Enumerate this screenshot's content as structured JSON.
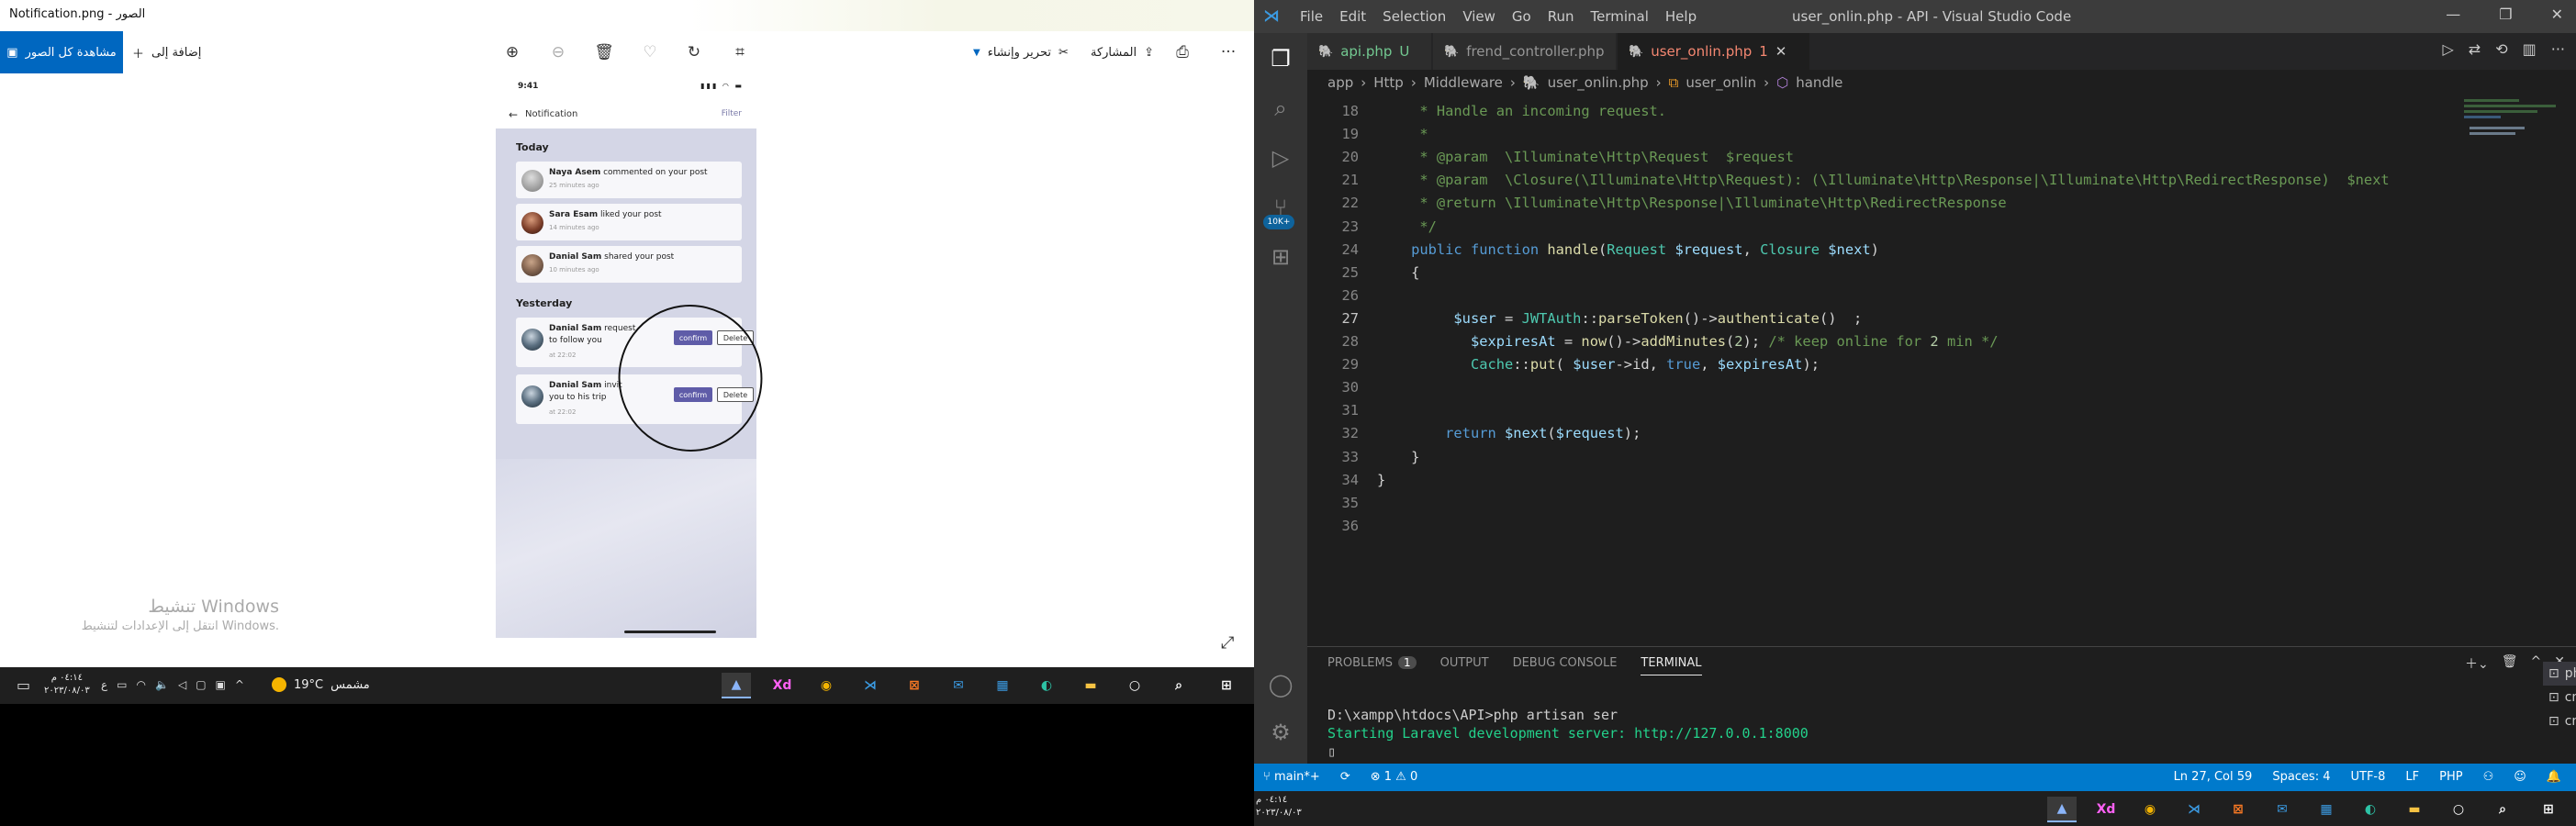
{
  "photos": {
    "window_title": "Notification.png - الصور",
    "toolbar": {
      "view_all": "مشاهدة كل الصور",
      "add_to": "إضافة إلى",
      "edit_create": "تحرير وإنشاء",
      "share": "المشاركة",
      "more": "···"
    },
    "phone": {
      "time": "9:41",
      "back_label": "Notification",
      "filter": "Filter",
      "today": "Today",
      "yesterday": "Yesterday",
      "notifications_today": [
        {
          "name": "Naya Asem",
          "text": "commented on your post",
          "ago": "25 minutes ago"
        },
        {
          "name": "Sara Esam",
          "text": "liked your post",
          "ago": "14 minutes ago"
        },
        {
          "name": "Danial Sam",
          "text": "shared your post",
          "ago": "10 minutes ago"
        }
      ],
      "notifications_yesterday": [
        {
          "name": "Danial Sam",
          "text": "request",
          "line2": "to follow you",
          "ago": "at 22:02"
        },
        {
          "name": "Danial Sam",
          "text": "invit",
          "line2": "you to his trip",
          "ago": "at 22:02"
        }
      ],
      "confirm": "confirm",
      "delete": "Delete"
    },
    "activate_windows": {
      "title": "تنشيط Windows",
      "subtitle": "انتقل إلى الإعدادات لتنشيط Windows."
    }
  },
  "taskbar_left": {
    "clock_time": "٠٤:١٤ م",
    "clock_date": "٢٠٢٣/٠٨/٠٣",
    "weather_label": "مشمس",
    "temperature": "19°C",
    "apps": [
      "photos",
      "xd",
      "chrome",
      "vscode",
      "xampp",
      "outlook",
      "store",
      "edge",
      "explorer",
      "cortana",
      "search",
      "start"
    ]
  },
  "vscode": {
    "menu": [
      "File",
      "Edit",
      "Selection",
      "View",
      "Go",
      "Run",
      "Terminal",
      "Help"
    ],
    "window_title": "user_onlin.php - API - Visual Studio Code",
    "tabs": [
      {
        "label": "api.php",
        "flag": "U"
      },
      {
        "label": "frend_controller.php",
        "flag": ""
      },
      {
        "label": "user_onlin.php",
        "flag": "1"
      }
    ],
    "breadcrumb": [
      "app",
      "Http",
      "Middleware",
      "user_onlin.php",
      "user_onlin",
      "handle"
    ],
    "activity_badge": "10K+",
    "lines": [
      {
        "n": "18",
        "text": "     * Handle an incoming request."
      },
      {
        "n": "19",
        "text": "     *"
      },
      {
        "n": "20",
        "text": "     * @param  \\Illuminate\\Http\\Request  $request"
      },
      {
        "n": "21",
        "text": "     * @param  \\Closure(\\Illuminate\\Http\\Request): (\\Illuminate\\Http\\Response|\\Illuminate\\Http\\RedirectResponse)  $next"
      },
      {
        "n": "22",
        "text": "     * @return \\Illuminate\\Http\\Response|\\Illuminate\\Http\\RedirectResponse"
      },
      {
        "n": "23",
        "text": "     */"
      },
      {
        "n": "24",
        "text": "    public function handle(Request $request, Closure $next)"
      },
      {
        "n": "25",
        "text": "    {"
      },
      {
        "n": "26",
        "text": ""
      },
      {
        "n": "27",
        "text": "         $user = JWTAuth::parseToken()->authenticate()  ;"
      },
      {
        "n": "28",
        "text": "           $expiresAt = now()->addMinutes(2); /* keep online for 2 min */"
      },
      {
        "n": "29",
        "text": "           Cache::put( $user->id, true, $expiresAt);"
      },
      {
        "n": "30",
        "text": ""
      },
      {
        "n": "31",
        "text": ""
      },
      {
        "n": "32",
        "text": "        return $next($request);"
      },
      {
        "n": "33",
        "text": "    }"
      },
      {
        "n": "34",
        "text": "}"
      },
      {
        "n": "35",
        "text": ""
      },
      {
        "n": "36",
        "text": ""
      }
    ],
    "panel": {
      "tabs": [
        "PROBLEMS",
        "OUTPUT",
        "DEBUG CONSOLE",
        "TERMINAL"
      ],
      "problems_count": "1",
      "terminal_lines": [
        "D:\\xampp\\htdocs\\API>php artisan ser",
        "Starting Laravel development server: http://127.0.0.1:8000"
      ],
      "terminals": [
        "php",
        "cmd",
        "cmd"
      ]
    },
    "statusbar": {
      "branch": "main*+",
      "errors": "1",
      "warnings": "0",
      "position": "Ln 27, Col 59",
      "spaces": "Spaces: 4",
      "encoding": "UTF-8",
      "eol": "LF",
      "language": "PHP"
    }
  },
  "taskbar_right": {
    "clock_time": "٠٤:١٤ م",
    "clock_date": "٢٠٢٣/٠٨/٠٣"
  },
  "colors": {
    "accent": "#0067c0",
    "vscode_status": "#007acc",
    "confirm_button": "#5f5ca8"
  }
}
